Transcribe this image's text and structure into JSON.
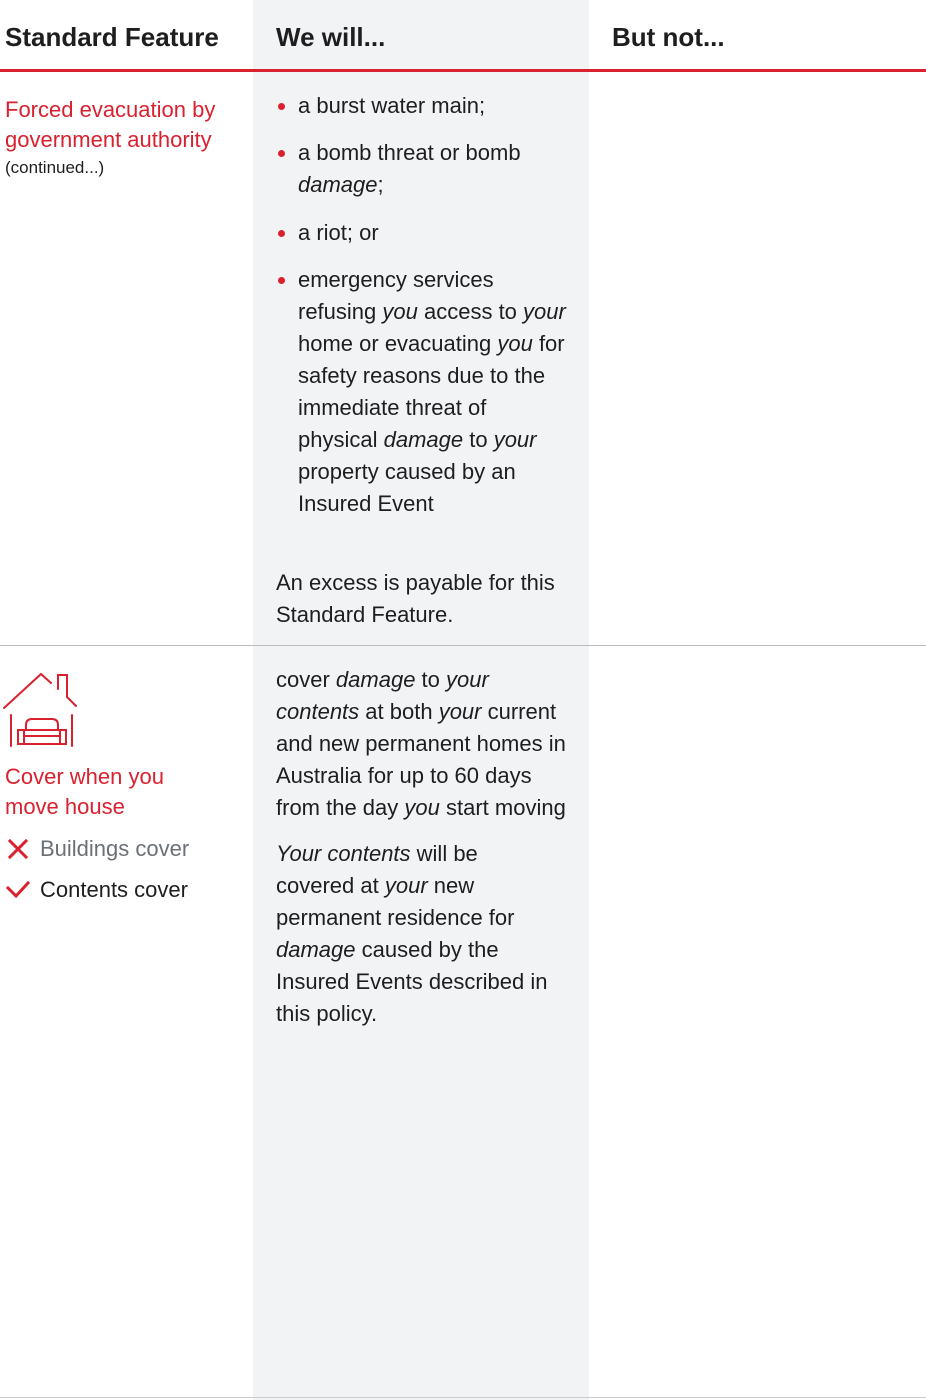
{
  "header": {
    "col1": "Standard Feature",
    "col2": "We will...",
    "col3": "But not..."
  },
  "row1": {
    "feature_title": "Forced evacuation by government authority",
    "continued": "(continued...)",
    "bullets": [
      [
        "a burst water main;"
      ],
      [
        "a bomb threat or bomb ",
        {
          "i": "damage"
        },
        ";"
      ],
      [
        "a riot; or"
      ],
      [
        "emergency services refusing ",
        {
          "i": "you"
        },
        " access to ",
        {
          "i": "your"
        },
        " home or evacuating ",
        {
          "i": "you"
        },
        " for safety reasons due to the immediate threat of physical ",
        {
          "i": "damage"
        },
        " to ",
        {
          "i": "your"
        },
        " property caused by an Insured Event"
      ]
    ],
    "excess_note": "An excess is payable for this Standard Feature."
  },
  "row2": {
    "icon": "house-sofa-icon",
    "feature_title": "Cover when you move house",
    "buildings_cover": "Buildings cover",
    "contents_cover": "Contents cover",
    "paragraphs": [
      [
        "cover ",
        {
          "i": "damage"
        },
        " to ",
        {
          "i": "your contents"
        },
        " at both ",
        {
          "i": "your"
        },
        " current and new permanent homes in Australia for up to 60 days from the day ",
        {
          "i": "you"
        },
        " start moving"
      ],
      [
        {
          "i": "Your contents"
        },
        " will be covered at ",
        {
          "i": "your"
        },
        " new permanent residence for ",
        {
          "i": "damage"
        },
        " caused by the Insured Events described in this policy."
      ]
    ]
  },
  "colors": {
    "accent_red": "#d9212f",
    "column_bg": "#f2f3f5",
    "muted_text": "#6b7077"
  }
}
